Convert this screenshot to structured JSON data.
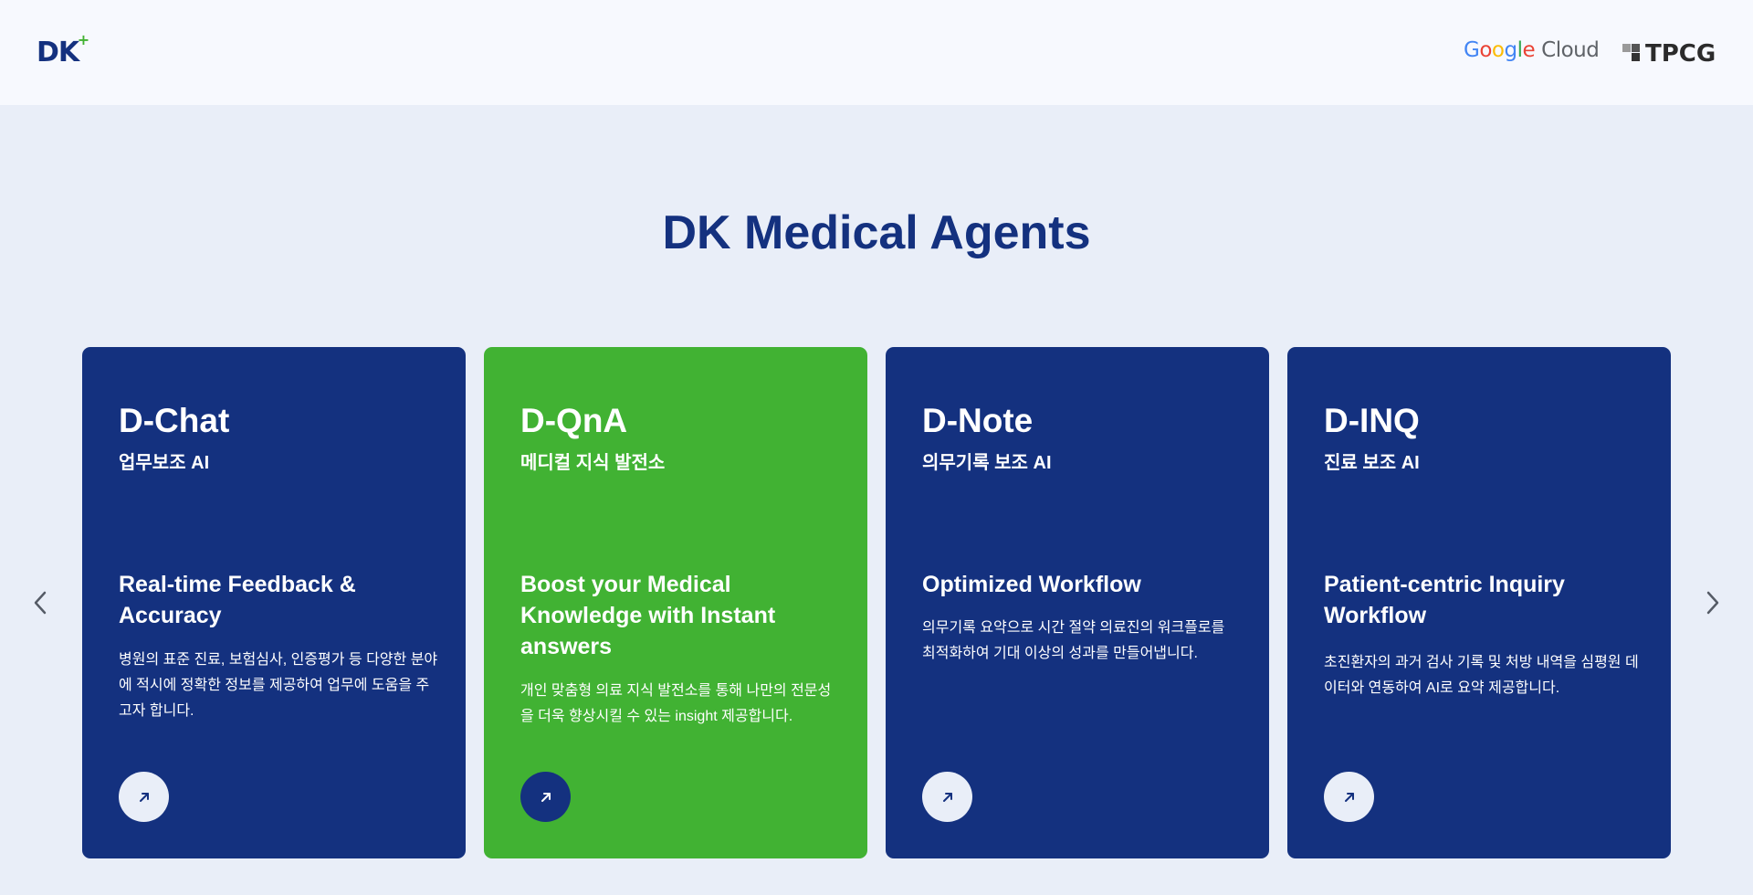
{
  "header": {
    "logo_text": "DK",
    "logo_plus": "+",
    "partners": {
      "google_letters": [
        "G",
        "o",
        "o",
        "g",
        "l",
        "e"
      ],
      "cloud_label": "Cloud",
      "tpcg_label": "TPCG"
    }
  },
  "main": {
    "title": "DK Medical Agents",
    "cards": [
      {
        "title": "D-Chat",
        "subtitle": "업무보조 AI",
        "heading": "Real-time Feedback & Accuracy",
        "description": "병원의 표준 진료, 보험심사, 인증평가 등 다양한 분야에 적시에 정확한 정보를 제공하여 업무에 도움을 주고자 합니다.",
        "color": "#14317f"
      },
      {
        "title": "D-QnA",
        "subtitle": "메디컬 지식 발전소",
        "heading": "Boost your Medical Knowledge with Instant answers",
        "description": "개인 맞춤형 의료 지식 발전소를 통해 나만의 전문성을 더욱 향상시킬 수 있는 insight 제공합니다.",
        "color": "#41b233"
      },
      {
        "title": "D-Note",
        "subtitle": "의무기록 보조 AI",
        "heading": "Optimized Workflow",
        "description": "의무기록 요약으로 시간 절약 의료진의 워크플로를 최적화하여 기대 이상의 성과를 만들어냅니다.",
        "color": "#14317f"
      },
      {
        "title": "D-INQ",
        "subtitle": "진료 보조 AI",
        "heading": "Patient-centric Inquiry Workflow",
        "description": "초진환자의 과거 검사 기록 및 처방 내역을 심평원 데이터와 연동하여 AI로 요약 제공합니다.",
        "color": "#14317f"
      }
    ]
  },
  "icons": {
    "prev": "chevron-left-icon",
    "next": "chevron-right-icon",
    "card_button": "arrow-up-right-icon"
  },
  "colors": {
    "navy": "#14317f",
    "green": "#41b233",
    "background": "#e9eef8",
    "header_bg": "#f7f9fe"
  }
}
